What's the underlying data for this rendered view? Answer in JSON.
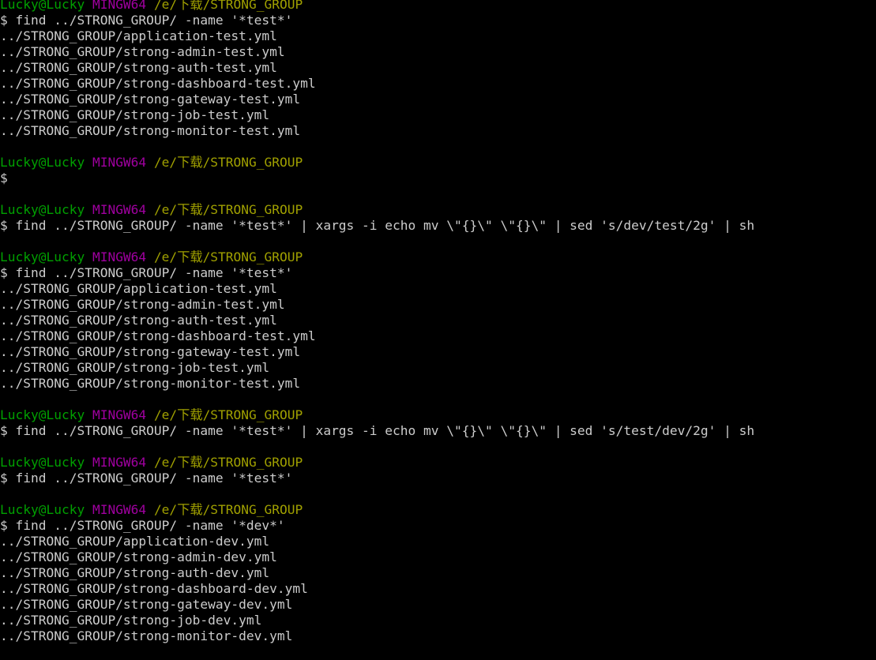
{
  "terminal": {
    "app": "MINGW64",
    "background": "#000000",
    "colors": {
      "user_host": "#00a000",
      "shell_tag": "#a000a0",
      "path": "#a0a000",
      "text": "#cccccc"
    },
    "prompt": {
      "user_host": "Lucky@Lucky",
      "shell_tag": "MINGW64",
      "path_prefix": "/e/",
      "path_cjk": "下载",
      "path_suffix": "/STRONG_GROUP",
      "symbol": "$ "
    },
    "commands": {
      "find_test": "find ../STRONG_GROUP/ -name '*test*'",
      "find_dev": "find ../STRONG_GROUP/ -name '*dev*'",
      "rename_dev_to_test": "find ../STRONG_GROUP/ -name '*test*' | xargs -i echo mv \\\"{}\\\" \\\"{}\\\" | sed 's/dev/test/2g' | sh",
      "rename_test_to_dev": "find ../STRONG_GROUP/ -name '*test*' | xargs -i echo mv \\\"{}\\\" \\\"{}\\\" | sed 's/test/dev/2g' | sh"
    },
    "output": {
      "test_files": [
        "../STRONG_GROUP/application-test.yml",
        "../STRONG_GROUP/strong-admin-test.yml",
        "../STRONG_GROUP/strong-auth-test.yml",
        "../STRONG_GROUP/strong-dashboard-test.yml",
        "../STRONG_GROUP/strong-gateway-test.yml",
        "../STRONG_GROUP/strong-job-test.yml",
        "../STRONG_GROUP/strong-monitor-test.yml"
      ],
      "dev_files": [
        "../STRONG_GROUP/application-dev.yml",
        "../STRONG_GROUP/strong-admin-dev.yml",
        "../STRONG_GROUP/strong-auth-dev.yml",
        "../STRONG_GROUP/strong-dashboard-dev.yml",
        "../STRONG_GROUP/strong-gateway-dev.yml",
        "../STRONG_GROUP/strong-job-dev.yml",
        "../STRONG_GROUP/strong-monitor-dev.yml"
      ]
    },
    "lines": [
      {
        "kind": "prompt"
      },
      {
        "kind": "command",
        "text": "$ find ../STRONG_GROUP/ -name '*test*'"
      },
      {
        "kind": "output",
        "text": "../STRONG_GROUP/application-test.yml"
      },
      {
        "kind": "output",
        "text": "../STRONG_GROUP/strong-admin-test.yml"
      },
      {
        "kind": "output",
        "text": "../STRONG_GROUP/strong-auth-test.yml"
      },
      {
        "kind": "output",
        "text": "../STRONG_GROUP/strong-dashboard-test.yml"
      },
      {
        "kind": "output",
        "text": "../STRONG_GROUP/strong-gateway-test.yml"
      },
      {
        "kind": "output",
        "text": "../STRONG_GROUP/strong-job-test.yml"
      },
      {
        "kind": "output",
        "text": "../STRONG_GROUP/strong-monitor-test.yml"
      },
      {
        "kind": "blank",
        "text": ""
      },
      {
        "kind": "prompt"
      },
      {
        "kind": "command",
        "text": "$"
      },
      {
        "kind": "blank",
        "text": ""
      },
      {
        "kind": "prompt"
      },
      {
        "kind": "command",
        "text": "$ find ../STRONG_GROUP/ -name '*test*' | xargs -i echo mv \\\"{}\\\" \\\"{}\\\" | sed 's/dev/test/2g' | sh"
      },
      {
        "kind": "blank",
        "text": ""
      },
      {
        "kind": "prompt"
      },
      {
        "kind": "command",
        "text": "$ find ../STRONG_GROUP/ -name '*test*'"
      },
      {
        "kind": "output",
        "text": "../STRONG_GROUP/application-test.yml"
      },
      {
        "kind": "output",
        "text": "../STRONG_GROUP/strong-admin-test.yml"
      },
      {
        "kind": "output",
        "text": "../STRONG_GROUP/strong-auth-test.yml"
      },
      {
        "kind": "output",
        "text": "../STRONG_GROUP/strong-dashboard-test.yml"
      },
      {
        "kind": "output",
        "text": "../STRONG_GROUP/strong-gateway-test.yml"
      },
      {
        "kind": "output",
        "text": "../STRONG_GROUP/strong-job-test.yml"
      },
      {
        "kind": "output",
        "text": "../STRONG_GROUP/strong-monitor-test.yml"
      },
      {
        "kind": "blank",
        "text": ""
      },
      {
        "kind": "prompt"
      },
      {
        "kind": "command",
        "text": "$ find ../STRONG_GROUP/ -name '*test*' | xargs -i echo mv \\\"{}\\\" \\\"{}\\\" | sed 's/test/dev/2g' | sh"
      },
      {
        "kind": "blank",
        "text": ""
      },
      {
        "kind": "prompt"
      },
      {
        "kind": "command",
        "text": "$ find ../STRONG_GROUP/ -name '*test*'"
      },
      {
        "kind": "blank",
        "text": ""
      },
      {
        "kind": "prompt"
      },
      {
        "kind": "command",
        "text": "$ find ../STRONG_GROUP/ -name '*dev*'"
      },
      {
        "kind": "output",
        "text": "../STRONG_GROUP/application-dev.yml"
      },
      {
        "kind": "output",
        "text": "../STRONG_GROUP/strong-admin-dev.yml"
      },
      {
        "kind": "output",
        "text": "../STRONG_GROUP/strong-auth-dev.yml"
      },
      {
        "kind": "output",
        "text": "../STRONG_GROUP/strong-dashboard-dev.yml"
      },
      {
        "kind": "output",
        "text": "../STRONG_GROUP/strong-gateway-dev.yml"
      },
      {
        "kind": "output",
        "text": "../STRONG_GROUP/strong-job-dev.yml"
      },
      {
        "kind": "output",
        "text": "../STRONG_GROUP/strong-monitor-dev.yml"
      }
    ]
  }
}
